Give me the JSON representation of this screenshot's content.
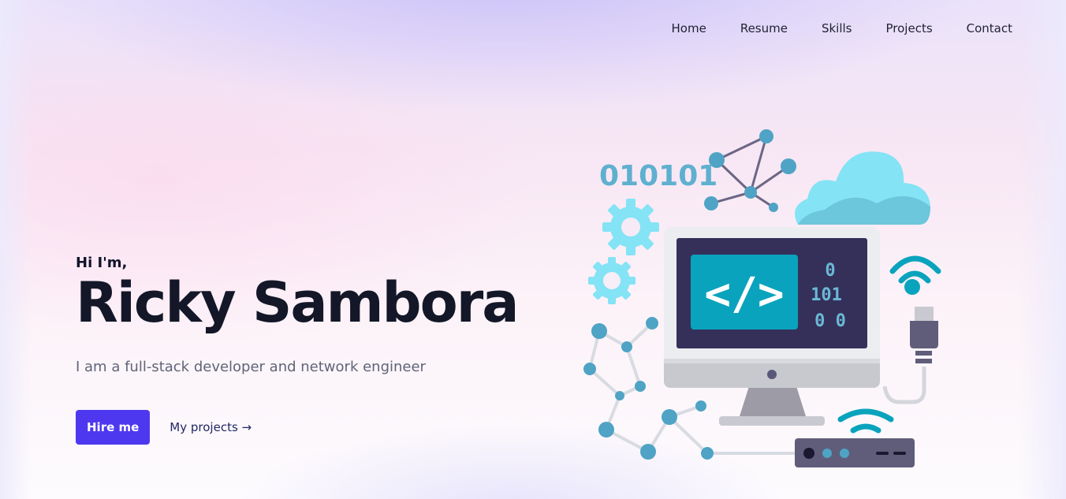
{
  "nav": {
    "items": [
      {
        "label": "Home"
      },
      {
        "label": "Resume"
      },
      {
        "label": "Skills"
      },
      {
        "label": "Projects"
      },
      {
        "label": "Contact"
      }
    ]
  },
  "hero": {
    "greeting": "Hi I'm,",
    "name": "Ricky Sambora",
    "tagline": "I am a full-stack developer and network engineer",
    "primary_button": "Hire me",
    "secondary_link": "My projects →"
  },
  "illustration": {
    "binary_text": "010101",
    "screen_code": "</>",
    "screen_bits": [
      "0",
      "101",
      "0 0"
    ],
    "colors": {
      "accent": "#4e38ef",
      "teal": "#0aa3bd",
      "sky": "#84e3f5",
      "node": "#4fa3c5",
      "monitor_frame": "#ecedf0",
      "screen": "#35305a"
    }
  }
}
